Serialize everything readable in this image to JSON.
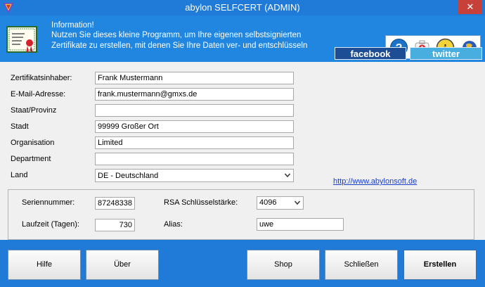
{
  "window": {
    "title": "abylon SELFCERT (ADMIN)",
    "close_glyph": "✕"
  },
  "header": {
    "info_title": "Information!",
    "info_line1": "Nutzen Sie dieses kleine Programm, um Ihre eigenen selbstsignierten",
    "info_line2": "Zertifikate zu erstellen, mit denen Sie Ihre Daten ver- und entschlüsseln",
    "icons": [
      "help-icon",
      "first-aid-icon",
      "info-icon",
      "globe-icon"
    ],
    "facebook_label": "facebook",
    "twitter_label": "twitter"
  },
  "form": {
    "fields": [
      {
        "label": "Zertifikatsinhaber:",
        "value": "Frank Mustermann"
      },
      {
        "label": "E-Mail-Adresse:",
        "value": "frank.mustermann@gmxs.de"
      },
      {
        "label": "Staat/Provinz",
        "value": ""
      },
      {
        "label": "Stadt",
        "value": "99999 Großer Ort"
      },
      {
        "label": "Organisation",
        "value": "Limited"
      },
      {
        "label": "Department",
        "value": ""
      }
    ],
    "country_label": "Land",
    "country_value": "DE - Deutschland",
    "link": "http://www.abylonsoft.de"
  },
  "options": {
    "serial_label": "Seriennummer:",
    "serial_value": "87248338",
    "duration_label": "Laufzeit (Tagen):",
    "duration_value": "730",
    "rsa_label": "RSA Schlüsselstärke:",
    "rsa_value": "4096",
    "alias_label": "Alias:",
    "alias_value": "uwe"
  },
  "buttons": {
    "help": "Hilfe",
    "about": "Über",
    "shop": "Shop",
    "close": "Schließen",
    "create": "Erstellen"
  },
  "colors": {
    "accent": "#1f7ad8",
    "close_red": "#c7403a",
    "facebook": "#1d4d94",
    "twitter": "#48aee0",
    "link": "#1a3fc7"
  }
}
